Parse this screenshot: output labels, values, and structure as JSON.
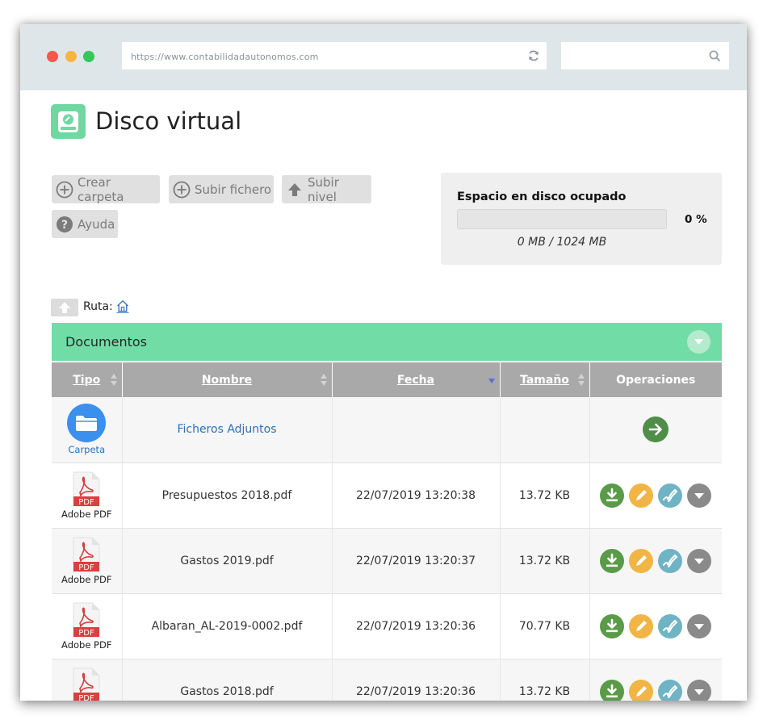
{
  "browser": {
    "url": "https://www.contabilidadautonomos.com",
    "search_placeholder": ""
  },
  "page": {
    "title": "Disco virtual",
    "accent_color": "#72dca6"
  },
  "toolbar": {
    "create_folder": "Crear carpeta",
    "upload_file": "Subir fichero",
    "level_up": "Subir nivel",
    "help": "Ayuda"
  },
  "disk": {
    "title": "Espacio en disco ocupado",
    "percent_label": "0 %",
    "used_fraction": 0,
    "usage": "0 MB / 1024 MB"
  },
  "path": {
    "label": "Ruta:"
  },
  "documents": {
    "title": "Documentos",
    "columns": {
      "type": "Tipo",
      "name": "Nombre",
      "date": "Fecha",
      "size": "Tamaño",
      "operations": "Operaciones"
    },
    "rows": [
      {
        "type": "Carpeta",
        "name": "Ficheros Adjuntos",
        "date": "",
        "size": ""
      },
      {
        "type": "Adobe PDF",
        "name": "Presupuestos 2018.pdf",
        "date": "22/07/2019 13:20:38",
        "size": "13.72 KB"
      },
      {
        "type": "Adobe PDF",
        "name": "Gastos 2019.pdf",
        "date": "22/07/2019 13:20:37",
        "size": "13.72 KB"
      },
      {
        "type": "Adobe PDF",
        "name": "Albaran_AL-2019-0002.pdf",
        "date": "22/07/2019 13:20:36",
        "size": "70.77 KB"
      },
      {
        "type": "Adobe PDF",
        "name": "Gastos 2018.pdf",
        "date": "22/07/2019 13:20:36",
        "size": "13.72 KB"
      }
    ]
  }
}
